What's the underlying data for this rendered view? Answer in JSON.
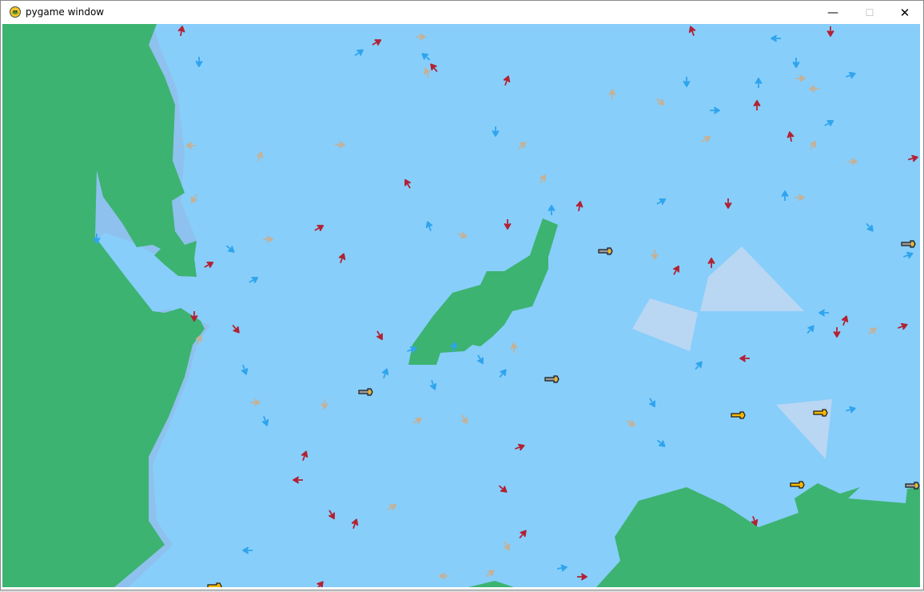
{
  "window": {
    "title": "pygame window",
    "minimize_glyph": "—",
    "maximize_glyph": "☐",
    "close_glyph": "✕",
    "icon": "pygame-snake-icon"
  },
  "game": {
    "water_color": "#87cefa",
    "land_color": "#3cb371",
    "shore_color": "#8ec1ee",
    "shoal_color": "#b9d6f2",
    "agent_types": {
      "red": "#b22234",
      "blue": "#2fa4ee",
      "tan": "#c3b29a"
    },
    "boat_colors": {
      "gray": "#9a9a9a",
      "yellow": "#f5b800"
    }
  }
}
